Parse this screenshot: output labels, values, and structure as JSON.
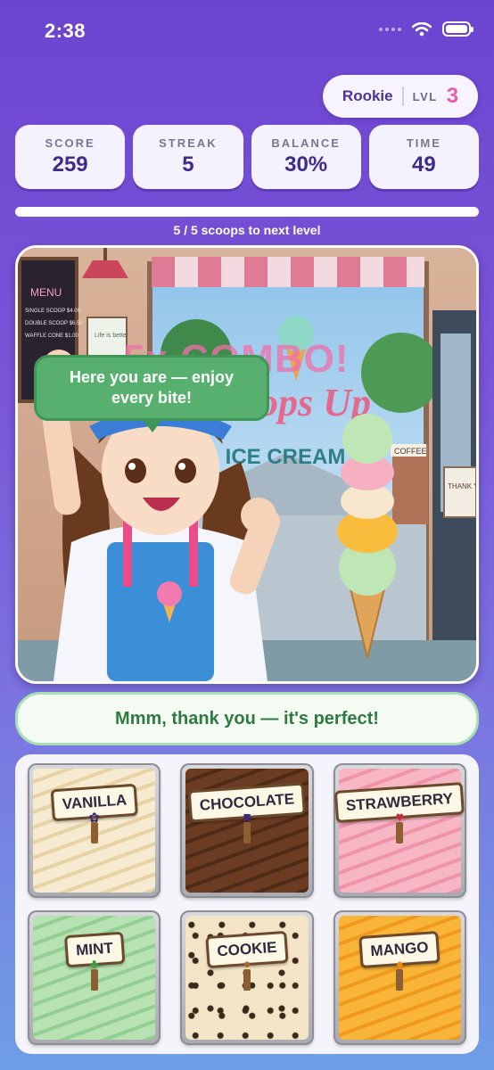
{
  "status_bar": {
    "time": "2:38"
  },
  "player": {
    "rank": "Rookie",
    "level_label": "LVL",
    "level": "3"
  },
  "stats": [
    {
      "label": "SCORE",
      "value": "259"
    },
    {
      "label": "STREAK",
      "value": "5"
    },
    {
      "label": "BALANCE",
      "value": "30%"
    },
    {
      "label": "TIME",
      "value": "49"
    }
  ],
  "progress": {
    "text": "5 / 5 scoops to next level",
    "current": 5,
    "total": 5
  },
  "scene": {
    "speech": "Here you are — enjoy every bite!",
    "combo": "5x COMBO!",
    "shop_sign": "Scoops Up",
    "shop_sub": "ICE CREAM",
    "menu_title": "MENU",
    "menu_items": [
      "SINGLE SCOOP $4.00",
      "DOUBLE SCOOP $6.50",
      "WAFFLE CONE $1.00"
    ],
    "poster": "Life is better",
    "thank_you": "THANK YOU!",
    "coffee": "COFFEE"
  },
  "dialog": {
    "text": "Mmm, thank you — it's perfect!"
  },
  "flavors": [
    {
      "label": "VANILLA",
      "color": "#f6ead0",
      "accent": "#e7d2a6",
      "icon": "vanilla-pod-icon"
    },
    {
      "label": "CHOCOLATE",
      "color": "#6b3b22",
      "accent": "#4f2a17",
      "icon": "chocolate-icon"
    },
    {
      "label": "STRAWBERRY",
      "color": "#f7b6c4",
      "accent": "#ef93a8",
      "icon": "strawberry-icon"
    },
    {
      "label": "MINT",
      "color": "#b8e2b4",
      "accent": "#94cf92",
      "icon": "mint-leaf-icon"
    },
    {
      "label": "COOKIE",
      "color": "#f3e4c6",
      "accent": "#3a2a1c",
      "icon": "cookie-icon"
    },
    {
      "label": "MANGO",
      "color": "#f9b43a",
      "accent": "#f09a1c",
      "icon": "mango-icon"
    }
  ]
}
